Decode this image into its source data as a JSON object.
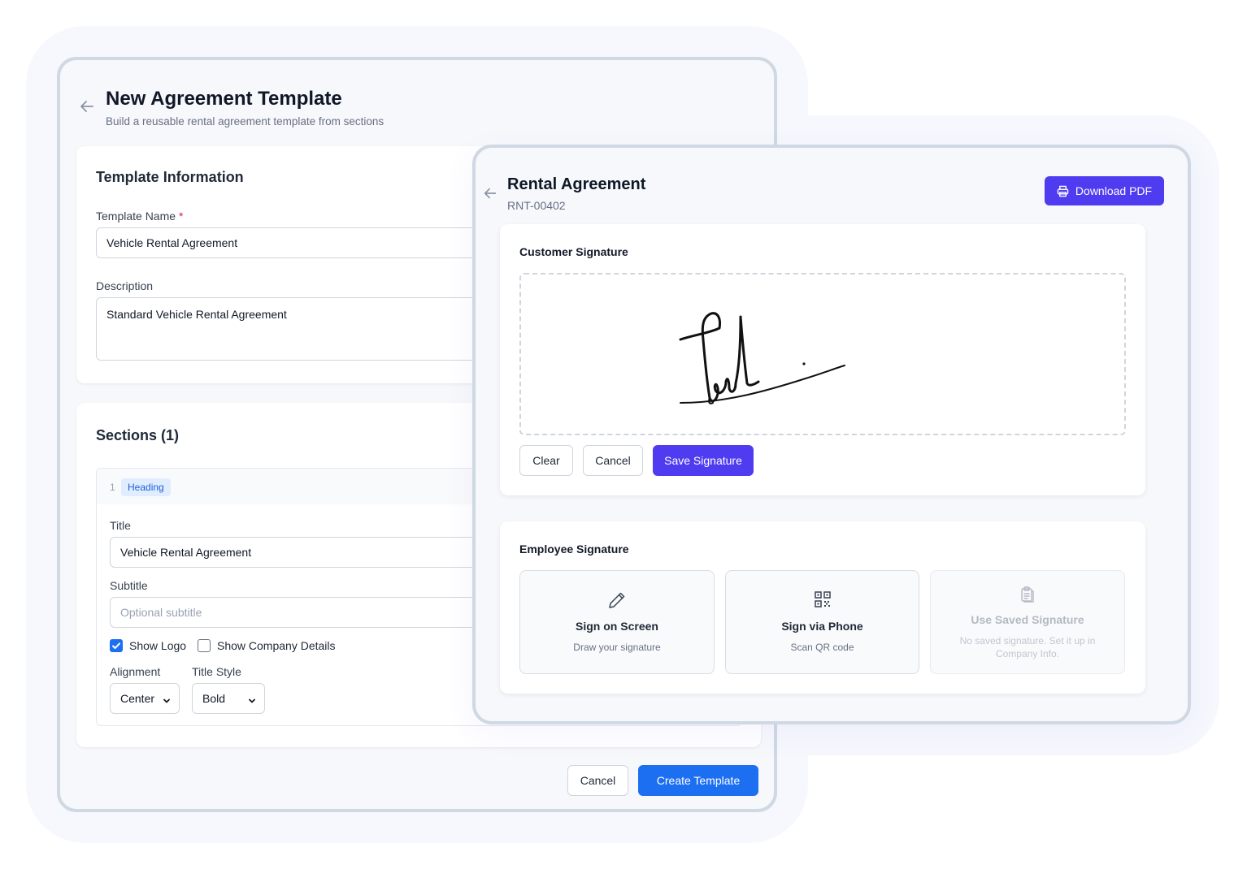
{
  "template_page": {
    "title": "New Agreement Template",
    "subtitle": "Build a reusable rental agreement template from sections",
    "info_card": {
      "heading": "Template Information",
      "name_label": "Template Name",
      "required_mark": "*",
      "name_value": "Vehicle Rental Agreement",
      "description_label": "Description",
      "description_value": "Standard Vehicle Rental Agreement"
    },
    "sections_card": {
      "heading": "Sections (1)",
      "section": {
        "number": "1",
        "type_badge": "Heading",
        "title_label": "Title",
        "title_value": "Vehicle Rental Agreement",
        "subtitle_label": "Subtitle",
        "subtitle_placeholder": "Optional subtitle",
        "show_logo_label": "Show Logo",
        "show_logo_checked": true,
        "show_company_label": "Show Company Details",
        "show_company_checked": false,
        "alignment_label": "Alignment",
        "alignment_value": "Center",
        "title_style_label": "Title Style",
        "title_style_value": "Bold"
      }
    },
    "footer": {
      "cancel_label": "Cancel",
      "create_label": "Create Template"
    }
  },
  "agreement_page": {
    "title": "Rental Agreement",
    "reference": "RNT-00402",
    "download_label": "Download PDF",
    "customer_signature": {
      "heading": "Customer Signature",
      "clear_label": "Clear",
      "cancel_label": "Cancel",
      "save_label": "Save Signature"
    },
    "employee_signature": {
      "heading": "Employee Signature",
      "options": [
        {
          "icon": "pencil-icon",
          "title": "Sign on Screen",
          "description": "Draw your signature"
        },
        {
          "icon": "qr-code-icon",
          "title": "Sign via Phone",
          "description": "Scan QR code"
        },
        {
          "icon": "clipboard-icon",
          "title": "Use Saved Signature",
          "description": "No saved signature. Set it up in Company Info."
        }
      ]
    }
  },
  "colors": {
    "primary_blue": "#1d6ff2",
    "primary_violet": "#4f3cf0",
    "window_border": "#cfd8e3",
    "badge_bg": "#e0edff"
  }
}
